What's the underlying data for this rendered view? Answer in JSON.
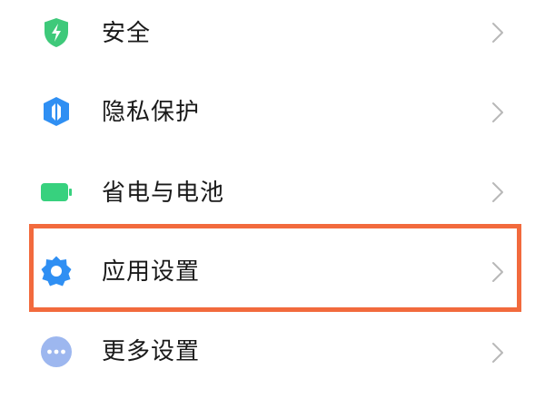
{
  "settings": {
    "items": [
      {
        "label": "安全",
        "icon": "shield-bolt-icon",
        "icon_color": "#3ec97a"
      },
      {
        "label": "隐私保护",
        "icon": "privacy-shield-icon",
        "icon_color": "#2f8ff3"
      },
      {
        "label": "省电与电池",
        "icon": "battery-icon",
        "icon_color": "#37d17e"
      },
      {
        "label": "应用设置",
        "icon": "gear-icon",
        "icon_color": "#2f8ff3"
      },
      {
        "label": "更多设置",
        "icon": "more-dots-icon",
        "icon_color": "#9db7ef"
      }
    ],
    "highlighted_item": "应用设置",
    "highlight_color": "#f26a3d",
    "chevron_color": "#b8b8b8"
  }
}
